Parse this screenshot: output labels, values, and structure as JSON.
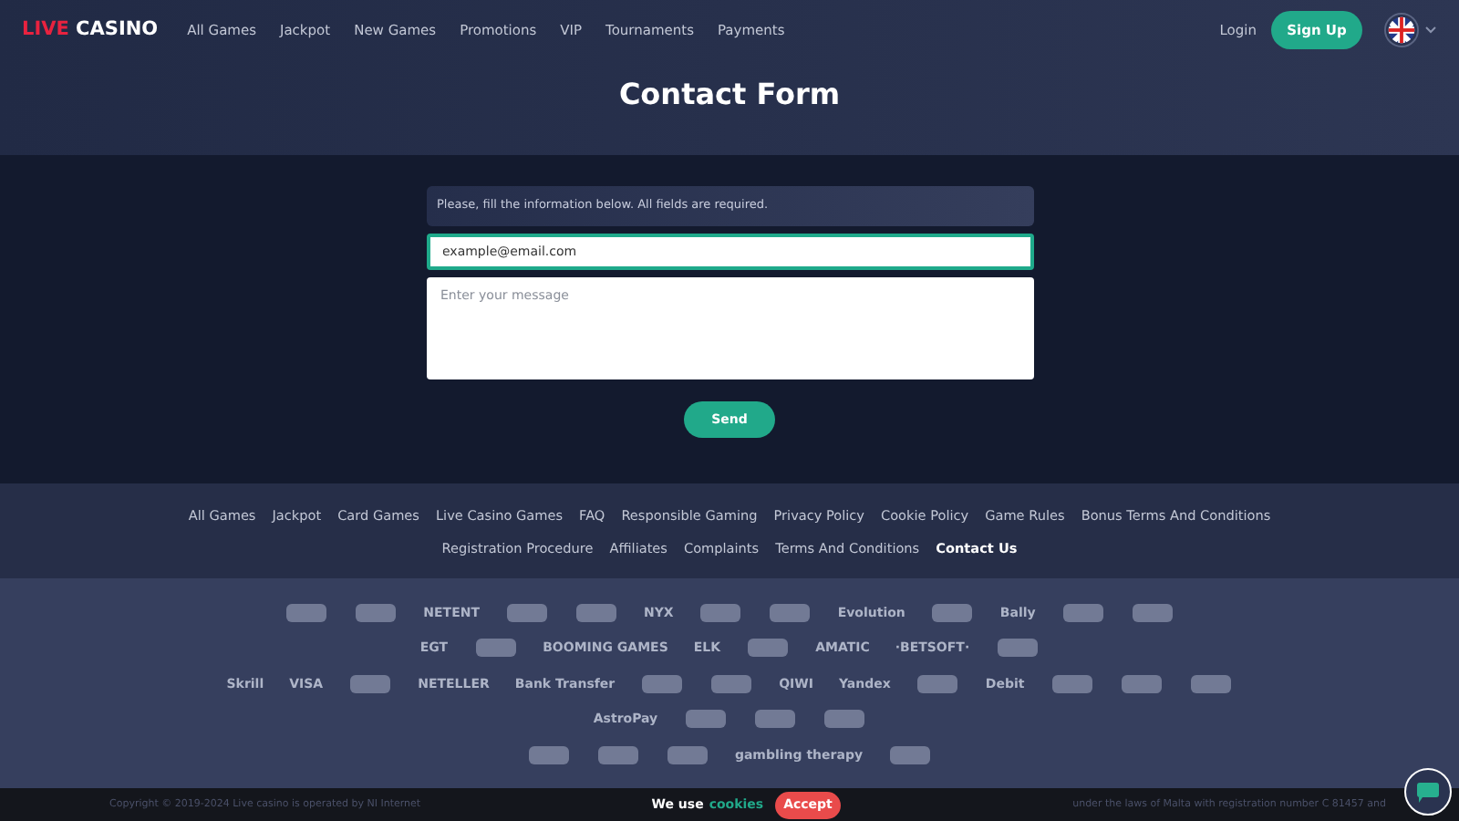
{
  "header": {
    "logo": {
      "accent": "LIVE",
      "rest": "CASINO"
    },
    "nav": [
      "All Games",
      "Jackpot",
      "New Games",
      "Promotions",
      "VIP",
      "Tournaments",
      "Payments"
    ],
    "login": "Login",
    "signup": "Sign Up"
  },
  "page_title": "Contact Form",
  "form": {
    "notice": "Please, fill the information below. All fields are required.",
    "email": {
      "value": "example@email.com",
      "focused": true
    },
    "message": {
      "placeholder": "Enter your message"
    },
    "submit": "Send"
  },
  "footer_links": [
    {
      "label": "All Games",
      "selected": false
    },
    {
      "label": "Jackpot",
      "selected": false
    },
    {
      "label": "Card Games",
      "selected": false
    },
    {
      "label": "Live Casino Games",
      "selected": false
    },
    {
      "label": "FAQ",
      "selected": false
    },
    {
      "label": "Responsible Gaming",
      "selected": false
    },
    {
      "label": "Privacy Policy",
      "selected": false
    },
    {
      "label": "Cookie Policy",
      "selected": false
    },
    {
      "label": "Game Rules",
      "selected": false
    },
    {
      "label": "Bonus Terms And Conditions",
      "selected": false
    },
    {
      "label": "Registration Procedure",
      "selected": false
    },
    {
      "label": "Affiliates",
      "selected": false
    },
    {
      "label": "Complaints",
      "selected": false
    },
    {
      "label": "Terms And Conditions",
      "selected": false
    },
    {
      "label": "Contact Us",
      "selected": true
    }
  ],
  "logo_rows": [
    [
      {
        "kind": "mark"
      },
      {
        "kind": "mark"
      },
      {
        "kind": "text",
        "label": "NETENT"
      },
      {
        "kind": "mark"
      },
      {
        "kind": "mark"
      },
      {
        "kind": "text",
        "label": "NYX"
      },
      {
        "kind": "mark"
      },
      {
        "kind": "mark"
      },
      {
        "kind": "text",
        "label": "Evolution"
      },
      {
        "kind": "mark"
      },
      {
        "kind": "text",
        "label": "Bally"
      },
      {
        "kind": "mark"
      },
      {
        "kind": "mark"
      }
    ],
    [
      {
        "kind": "text",
        "label": "EGT"
      },
      {
        "kind": "mark"
      },
      {
        "kind": "text",
        "label": "BOOMING GAMES"
      },
      {
        "kind": "text",
        "label": "ELK"
      },
      {
        "kind": "mark"
      },
      {
        "kind": "text",
        "label": "AMATIC"
      },
      {
        "kind": "text",
        "label": "·BETSOFT·"
      },
      {
        "kind": "mark"
      }
    ],
    [
      {
        "kind": "text",
        "label": "Skrill"
      },
      {
        "kind": "text",
        "label": "VISA"
      },
      {
        "kind": "mark"
      },
      {
        "kind": "text",
        "label": "NETELLER"
      },
      {
        "kind": "text",
        "label": "Bank Transfer"
      },
      {
        "kind": "mark"
      },
      {
        "kind": "mark"
      },
      {
        "kind": "text",
        "label": "QIWI"
      },
      {
        "kind": "text",
        "label": "Yandex"
      },
      {
        "kind": "mark"
      },
      {
        "kind": "text",
        "label": "Debit"
      },
      {
        "kind": "mark"
      },
      {
        "kind": "mark"
      },
      {
        "kind": "mark"
      }
    ],
    [
      {
        "kind": "text",
        "label": "AstroPay"
      },
      {
        "kind": "mark"
      },
      {
        "kind": "mark"
      },
      {
        "kind": "mark"
      }
    ],
    [
      {
        "kind": "mark"
      },
      {
        "kind": "mark"
      },
      {
        "kind": "mark"
      },
      {
        "kind": "text",
        "label": "gambling therapy"
      },
      {
        "kind": "mark"
      }
    ]
  ],
  "copyright": {
    "left": "Copyright © 2019-2024 Live casino is operated by NI Internet",
    "right": "under the laws of Malta with registration number C 81457 and"
  },
  "cookie_bar": {
    "text": "We use",
    "link": "cookies",
    "accept": "Accept"
  }
}
